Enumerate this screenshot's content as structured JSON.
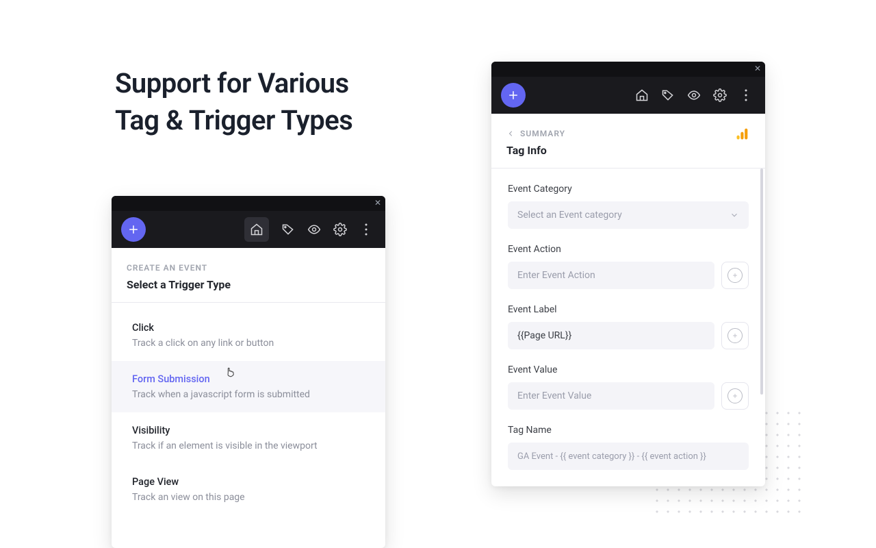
{
  "marketing": {
    "headline_line1": "Support for Various",
    "headline_line2": "Tag & Trigger Types"
  },
  "panel_a": {
    "eyebrow": "CREATE AN EVENT",
    "title": "Select a Trigger Type",
    "options": [
      {
        "title": "Click",
        "desc": "Track a click on any link or button"
      },
      {
        "title": "Form Submission",
        "desc": "Track when a javascript form is submitted"
      },
      {
        "title": "Visibility",
        "desc": "Track if an element is visible in the viewport"
      },
      {
        "title": "Page View",
        "desc": "Track an view on this page"
      }
    ]
  },
  "panel_b": {
    "eyebrow": "SUMMARY",
    "title": "Tag Info",
    "fields": {
      "event_category": {
        "label": "Event Category",
        "placeholder": "Select an Event category"
      },
      "event_action": {
        "label": "Event Action",
        "placeholder": "Enter Event Action"
      },
      "event_label": {
        "label": "Event Label",
        "value": "{{Page URL}}"
      },
      "event_value": {
        "label": "Event Value",
        "placeholder": "Enter Event Value"
      },
      "tag_name": {
        "label": "Tag Name",
        "value": "GA Event - {{ event category }} - {{ event action }}"
      }
    }
  }
}
